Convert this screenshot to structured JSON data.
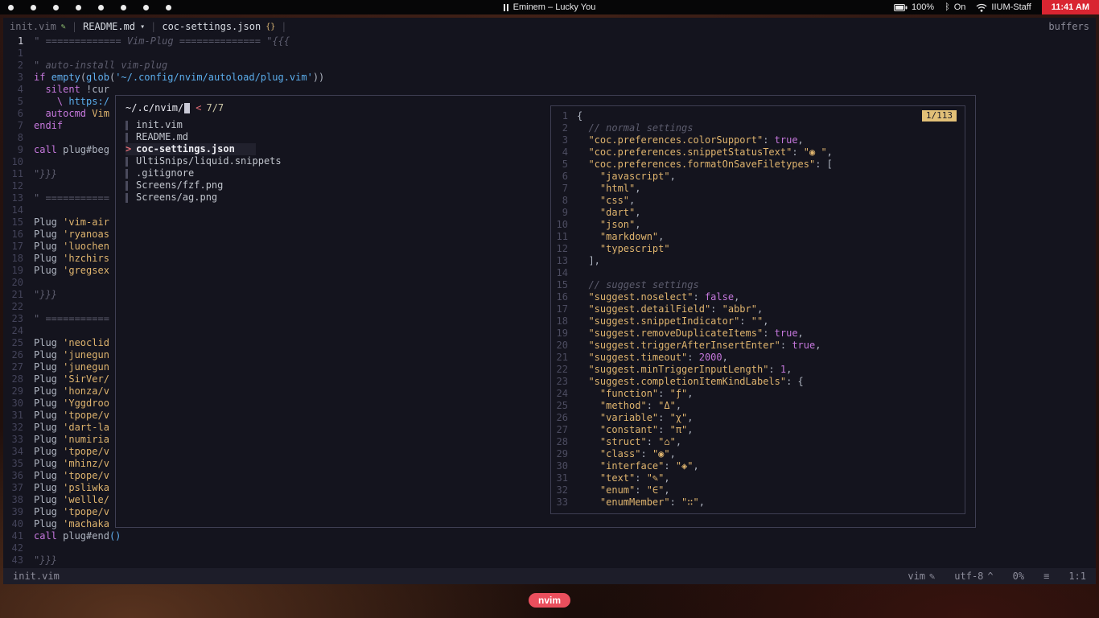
{
  "menubar": {
    "app_icon_count": 8,
    "now_playing": "Eminem – Lucky You",
    "battery": "100%",
    "bluetooth": "On",
    "wifi": "IIUM-Staff",
    "time": "11:41 AM"
  },
  "tabline": {
    "buffers": [
      {
        "label": "init.vim",
        "icon": "✎",
        "icon_name": "vim-icon",
        "active": false
      },
      {
        "label": "README.md",
        "icon": "▾",
        "icon_name": "markdown-icon",
        "active": true
      },
      {
        "label": "coc-settings.json",
        "icon": "{}",
        "icon_name": "json-icon",
        "active": true
      }
    ],
    "right": "buffers"
  },
  "editor": {
    "lines": [
      {
        "n": "1",
        "cur": true,
        "t": [
          [
            "c",
            "\" ============= Vim-Plug ============== \"{{{"
          ]
        ]
      },
      {
        "n": "1",
        "t": []
      },
      {
        "n": "2",
        "t": [
          [
            "c",
            "\" auto-install vim-plug"
          ]
        ]
      },
      {
        "n": "3",
        "t": [
          [
            "k",
            "if"
          ],
          [
            "n",
            " "
          ],
          [
            "f",
            "empty"
          ],
          [
            "n",
            "("
          ],
          [
            "f",
            "glob"
          ],
          [
            "n",
            "("
          ],
          [
            "s",
            "'~/.config/nvim/autoload/plug.vim'"
          ],
          [
            "n",
            "))"
          ]
        ]
      },
      {
        "n": "4",
        "t": [
          [
            "n",
            "  "
          ],
          [
            "k",
            "silent"
          ],
          [
            "n",
            " !cur"
          ]
        ]
      },
      {
        "n": "5",
        "t": [
          [
            "k",
            "    \\"
          ],
          [
            "s",
            " https:/"
          ]
        ]
      },
      {
        "n": "6",
        "t": [
          [
            "n",
            "  "
          ],
          [
            "k",
            "autocmd"
          ],
          [
            "n",
            " "
          ],
          [
            "y",
            "Vim"
          ]
        ]
      },
      {
        "n": "7",
        "t": [
          [
            "k",
            "endif"
          ]
        ]
      },
      {
        "n": "8",
        "t": []
      },
      {
        "n": "9",
        "t": [
          [
            "k",
            "call"
          ],
          [
            "n",
            " plug#beg"
          ]
        ]
      },
      {
        "n": "10",
        "t": []
      },
      {
        "n": "11",
        "t": [
          [
            "c",
            "\"}}}"
          ]
        ]
      },
      {
        "n": "12",
        "t": []
      },
      {
        "n": "13",
        "t": [
          [
            "c",
            "\" ==========="
          ]
        ]
      },
      {
        "n": "14",
        "t": []
      },
      {
        "n": "15",
        "t": [
          [
            "n",
            "Plug "
          ],
          [
            "y",
            "'vim-air"
          ]
        ]
      },
      {
        "n": "16",
        "t": [
          [
            "n",
            "Plug "
          ],
          [
            "y",
            "'ryanoas"
          ]
        ]
      },
      {
        "n": "17",
        "t": [
          [
            "n",
            "Plug "
          ],
          [
            "y",
            "'luochen"
          ]
        ]
      },
      {
        "n": "18",
        "t": [
          [
            "n",
            "Plug "
          ],
          [
            "y",
            "'hzchirs"
          ]
        ]
      },
      {
        "n": "19",
        "t": [
          [
            "n",
            "Plug "
          ],
          [
            "y",
            "'gregsex"
          ]
        ]
      },
      {
        "n": "20",
        "t": []
      },
      {
        "n": "21",
        "t": [
          [
            "c",
            "\"}}}"
          ]
        ]
      },
      {
        "n": "22",
        "t": []
      },
      {
        "n": "23",
        "t": [
          [
            "c",
            "\" ==========="
          ]
        ]
      },
      {
        "n": "24",
        "t": []
      },
      {
        "n": "25",
        "t": [
          [
            "n",
            "Plug "
          ],
          [
            "y",
            "'neoclid"
          ]
        ]
      },
      {
        "n": "26",
        "t": [
          [
            "n",
            "Plug "
          ],
          [
            "y",
            "'junegun"
          ]
        ]
      },
      {
        "n": "27",
        "t": [
          [
            "n",
            "Plug "
          ],
          [
            "y",
            "'junegun"
          ]
        ]
      },
      {
        "n": "28",
        "t": [
          [
            "n",
            "Plug "
          ],
          [
            "y",
            "'SirVer/"
          ]
        ]
      },
      {
        "n": "29",
        "t": [
          [
            "n",
            "Plug "
          ],
          [
            "y",
            "'honza/v"
          ]
        ]
      },
      {
        "n": "30",
        "t": [
          [
            "n",
            "Plug "
          ],
          [
            "y",
            "'Yggdroo"
          ]
        ]
      },
      {
        "n": "31",
        "t": [
          [
            "n",
            "Plug "
          ],
          [
            "y",
            "'tpope/v"
          ]
        ]
      },
      {
        "n": "32",
        "t": [
          [
            "n",
            "Plug "
          ],
          [
            "y",
            "'dart-la"
          ]
        ]
      },
      {
        "n": "33",
        "t": [
          [
            "n",
            "Plug "
          ],
          [
            "y",
            "'numiria"
          ]
        ]
      },
      {
        "n": "34",
        "t": [
          [
            "n",
            "Plug "
          ],
          [
            "y",
            "'tpope/v"
          ]
        ]
      },
      {
        "n": "35",
        "t": [
          [
            "n",
            "Plug "
          ],
          [
            "y",
            "'mhinz/v"
          ]
        ]
      },
      {
        "n": "36",
        "t": [
          [
            "n",
            "Plug "
          ],
          [
            "y",
            "'tpope/v"
          ]
        ]
      },
      {
        "n": "37",
        "t": [
          [
            "n",
            "Plug "
          ],
          [
            "y",
            "'psliwka"
          ]
        ]
      },
      {
        "n": "38",
        "t": [
          [
            "n",
            "Plug "
          ],
          [
            "y",
            "'wellle/"
          ]
        ]
      },
      {
        "n": "39",
        "t": [
          [
            "n",
            "Plug "
          ],
          [
            "y",
            "'tpope/v"
          ]
        ]
      },
      {
        "n": "40",
        "t": [
          [
            "n",
            "Plug "
          ],
          [
            "y",
            "'machaka"
          ]
        ]
      },
      {
        "n": "41",
        "t": [
          [
            "k",
            "call"
          ],
          [
            "n",
            " plug#end"
          ],
          [
            "f",
            "()"
          ]
        ]
      },
      {
        "n": "42",
        "t": []
      },
      {
        "n": "43",
        "t": [
          [
            "c",
            "\"}}}"
          ]
        ]
      }
    ]
  },
  "fzf": {
    "prompt_path": "~/.c/nvim/",
    "arrow": "<",
    "counter": "7/7",
    "items": [
      {
        "label": "init.vim",
        "selected": false
      },
      {
        "label": "README.md",
        "selected": false
      },
      {
        "label": "coc-settings.json",
        "selected": true
      },
      {
        "label": "UltiSnips/liquid.snippets",
        "selected": false
      },
      {
        "label": ".gitignore",
        "selected": false
      },
      {
        "label": "Screens/fzf.png",
        "selected": false
      },
      {
        "label": "Screens/ag.png",
        "selected": false
      }
    ]
  },
  "preview": {
    "badge": "1/113",
    "lines": [
      {
        "n": "1",
        "t": [
          [
            "n",
            "{"
          ]
        ]
      },
      {
        "n": "2",
        "t": [
          [
            "c",
            "  // normal settings"
          ]
        ]
      },
      {
        "n": "3",
        "t": [
          [
            "y",
            "  \"coc.preferences.colorSupport\""
          ],
          [
            "n",
            ": "
          ],
          [
            "k",
            "true"
          ],
          [
            "n",
            ","
          ]
        ]
      },
      {
        "n": "4",
        "t": [
          [
            "y",
            "  \"coc.preferences.snippetStatusText\""
          ],
          [
            "n",
            ": "
          ],
          [
            "y",
            "\"◉ \""
          ],
          [
            "n",
            ","
          ]
        ]
      },
      {
        "n": "5",
        "t": [
          [
            "y",
            "  \"coc.preferences.formatOnSaveFiletypes\""
          ],
          [
            "n",
            ": ["
          ]
        ]
      },
      {
        "n": "6",
        "t": [
          [
            "y",
            "    \"javascript\""
          ],
          [
            "n",
            ","
          ]
        ]
      },
      {
        "n": "7",
        "t": [
          [
            "y",
            "    \"html\""
          ],
          [
            "n",
            ","
          ]
        ]
      },
      {
        "n": "8",
        "t": [
          [
            "y",
            "    \"css\""
          ],
          [
            "n",
            ","
          ]
        ]
      },
      {
        "n": "9",
        "t": [
          [
            "y",
            "    \"dart\""
          ],
          [
            "n",
            ","
          ]
        ]
      },
      {
        "n": "10",
        "t": [
          [
            "y",
            "    \"json\""
          ],
          [
            "n",
            ","
          ]
        ]
      },
      {
        "n": "11",
        "t": [
          [
            "y",
            "    \"markdown\""
          ],
          [
            "n",
            ","
          ]
        ]
      },
      {
        "n": "12",
        "t": [
          [
            "y",
            "    \"typescript\""
          ]
        ]
      },
      {
        "n": "13",
        "t": [
          [
            "n",
            "  ],"
          ]
        ]
      },
      {
        "n": "14",
        "t": []
      },
      {
        "n": "15",
        "t": [
          [
            "c",
            "  // suggest settings"
          ]
        ]
      },
      {
        "n": "16",
        "t": [
          [
            "y",
            "  \"suggest.noselect\""
          ],
          [
            "n",
            ": "
          ],
          [
            "k",
            "false"
          ],
          [
            "n",
            ","
          ]
        ]
      },
      {
        "n": "17",
        "t": [
          [
            "y",
            "  \"suggest.detailField\""
          ],
          [
            "n",
            ": "
          ],
          [
            "y",
            "\"abbr\""
          ],
          [
            "n",
            ","
          ]
        ]
      },
      {
        "n": "18",
        "t": [
          [
            "y",
            "  \"suggest.snippetIndicator\""
          ],
          [
            "n",
            ": "
          ],
          [
            "y",
            "\"\""
          ],
          [
            "n",
            ","
          ]
        ]
      },
      {
        "n": "19",
        "t": [
          [
            "y",
            "  \"suggest.removeDuplicateItems\""
          ],
          [
            "n",
            ": "
          ],
          [
            "k",
            "true"
          ],
          [
            "n",
            ","
          ]
        ]
      },
      {
        "n": "20",
        "t": [
          [
            "y",
            "  \"suggest.triggerAfterInsertEnter\""
          ],
          [
            "n",
            ": "
          ],
          [
            "k",
            "true"
          ],
          [
            "n",
            ","
          ]
        ]
      },
      {
        "n": "21",
        "t": [
          [
            "y",
            "  \"suggest.timeout\""
          ],
          [
            "n",
            ": "
          ],
          [
            "k",
            "2000"
          ],
          [
            "n",
            ","
          ]
        ]
      },
      {
        "n": "22",
        "t": [
          [
            "y",
            "  \"suggest.minTriggerInputLength\""
          ],
          [
            "n",
            ": "
          ],
          [
            "k",
            "1"
          ],
          [
            "n",
            ","
          ]
        ]
      },
      {
        "n": "23",
        "t": [
          [
            "y",
            "  \"suggest.completionItemKindLabels\""
          ],
          [
            "n",
            ": {"
          ]
        ]
      },
      {
        "n": "24",
        "t": [
          [
            "y",
            "    \"function\""
          ],
          [
            "n",
            ": "
          ],
          [
            "y",
            "\"ƒ\""
          ],
          [
            "n",
            ","
          ]
        ]
      },
      {
        "n": "25",
        "t": [
          [
            "y",
            "    \"method\""
          ],
          [
            "n",
            ": "
          ],
          [
            "y",
            "\"Δ\""
          ],
          [
            "n",
            ","
          ]
        ]
      },
      {
        "n": "26",
        "t": [
          [
            "y",
            "    \"variable\""
          ],
          [
            "n",
            ": "
          ],
          [
            "y",
            "\"χ\""
          ],
          [
            "n",
            ","
          ]
        ]
      },
      {
        "n": "27",
        "t": [
          [
            "y",
            "    \"constant\""
          ],
          [
            "n",
            ": "
          ],
          [
            "y",
            "\"π\""
          ],
          [
            "n",
            ","
          ]
        ]
      },
      {
        "n": "28",
        "t": [
          [
            "y",
            "    \"struct\""
          ],
          [
            "n",
            ": "
          ],
          [
            "y",
            "\"⌂\""
          ],
          [
            "n",
            ","
          ]
        ]
      },
      {
        "n": "29",
        "t": [
          [
            "y",
            "    \"class\""
          ],
          [
            "n",
            ": "
          ],
          [
            "y",
            "\"◉\""
          ],
          [
            "n",
            ","
          ]
        ]
      },
      {
        "n": "30",
        "t": [
          [
            "y",
            "    \"interface\""
          ],
          [
            "n",
            ": "
          ],
          [
            "y",
            "\"◈\""
          ],
          [
            "n",
            ","
          ]
        ]
      },
      {
        "n": "31",
        "t": [
          [
            "y",
            "    \"text\""
          ],
          [
            "n",
            ": "
          ],
          [
            "y",
            "\"✎\""
          ],
          [
            "n",
            ","
          ]
        ]
      },
      {
        "n": "32",
        "t": [
          [
            "y",
            "    \"enum\""
          ],
          [
            "n",
            ": "
          ],
          [
            "y",
            "\"∈\""
          ],
          [
            "n",
            ","
          ]
        ]
      },
      {
        "n": "33",
        "t": [
          [
            "y",
            "    \"enumMember\""
          ],
          [
            "n",
            ": "
          ],
          [
            "y",
            "\"∷\""
          ],
          [
            "n",
            ","
          ]
        ]
      }
    ]
  },
  "statusline": {
    "left": "init.vim",
    "filetype": "vim",
    "filetype_icon": "✎",
    "encoding": "utf-8",
    "encoding_icon": "^",
    "percent": "0%",
    "lines_icon": "≡",
    "position": "1:1"
  },
  "dock": {
    "label": "nvim"
  },
  "colors": {
    "accent_red": "#e06c75",
    "badge_yellow": "#e2c077",
    "keyword_purple": "#c678dd",
    "function_blue": "#61afef",
    "terminal_bg": "#14141e"
  }
}
